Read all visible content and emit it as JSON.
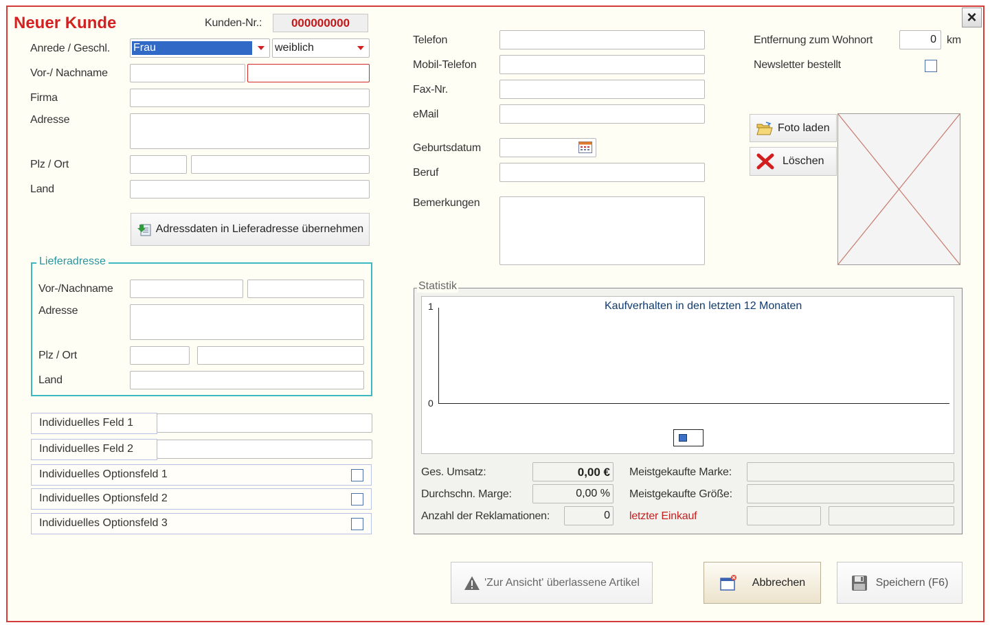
{
  "header": {
    "title": "Neuer Kunde",
    "kundennr_label": "Kunden-Nr.:",
    "kundennr_value": "000000000",
    "close": "×"
  },
  "left": {
    "anrede_label": "Anrede / Geschl.",
    "anrede_value": "Frau",
    "geschlecht_value": "weiblich",
    "name_label": "Vor-/ Nachname",
    "firma_label": "Firma",
    "adresse_label": "Adresse",
    "plz_label": "Plz / Ort",
    "land_label": "Land",
    "copy_button": "Adressdaten in Lieferadresse übernehmen"
  },
  "liefer": {
    "title": "Lieferadresse",
    "name_label": "Vor-/Nachname",
    "adresse_label": "Adresse",
    "plz_label": "Plz / Ort",
    "land_label": "Land"
  },
  "custom": {
    "feld1": "Individuelles Feld 1",
    "feld2": "Individuelles Feld 2",
    "opt1": "Individuelles Optionsfeld 1",
    "opt2": "Individuelles Optionsfeld 2",
    "opt3": "Individuelles Optionsfeld 3"
  },
  "contact": {
    "telefon": "Telefon",
    "mobil": "Mobil-Telefon",
    "fax": "Fax-Nr.",
    "email": "eMail",
    "geburtsdatum": "Geburtsdatum",
    "beruf": "Beruf",
    "bemerkungen": "Bemerkungen"
  },
  "right": {
    "entfernung_label": "Entfernung zum Wohnort",
    "entfernung_value": "0",
    "entfernung_unit": "km",
    "newsletter_label": "Newsletter bestellt",
    "foto_laden": "Foto laden",
    "loeschen": "Löschen"
  },
  "statistik": {
    "title": "Statistik",
    "chart_title": "Kaufverhalten in den letzten 12 Monaten",
    "y_max": "1",
    "y_min": "0",
    "umsatz_label": "Ges. Umsatz:",
    "umsatz_value": "0,00 €",
    "marge_label": "Durchschn. Marge:",
    "marge_value": "0,00 %",
    "reklamationen_label": "Anzahl der Reklamationen:",
    "reklamationen_value": "0",
    "marke_label": "Meistgekaufte Marke:",
    "groesse_label": "Meistgekaufte Größe:",
    "letzter_label": "letzter Einkauf"
  },
  "chart_data": {
    "type": "line",
    "title": "Kaufverhalten in den letzten 12 Monaten",
    "ylim": [
      0,
      1
    ],
    "y_ticks": [
      "0",
      "1"
    ],
    "series": [
      {
        "values": []
      }
    ]
  },
  "footer": {
    "ansicht": "'Zur Ansicht' überlassene Artikel",
    "abbrechen": "Abbrechen",
    "speichern": "Speichern (F6)"
  }
}
